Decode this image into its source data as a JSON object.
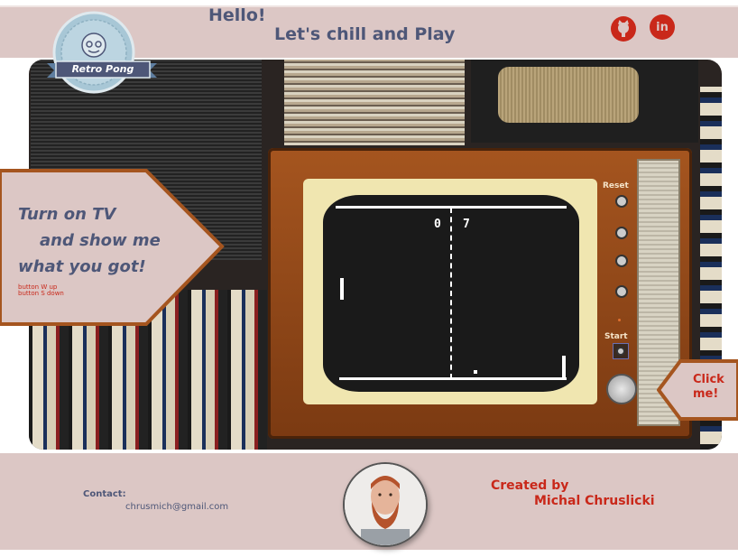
{
  "header": {
    "greeting": "Hello!",
    "tagline": "Let's chill and Play",
    "logo_text": "Retro Pong",
    "github_icon": "github-icon",
    "linkedin_icon": "linkedin-icon",
    "linkedin_label": "in"
  },
  "game": {
    "score_left": "0",
    "score_right": "7",
    "reset_label": "Reset",
    "start_label": "Start"
  },
  "callout": {
    "line1": "Turn on TV",
    "line2": "and show me",
    "line3": "what you got!",
    "hint_up": "button W up",
    "hint_down": "button S down"
  },
  "click_callout": {
    "text": "Click me!"
  },
  "footer": {
    "contact_label": "Contact:",
    "contact_email": "chrusmich@gmail.com",
    "created_by": "Created by",
    "author": "Michal Chruslicki"
  },
  "colors": {
    "bar_bg": "#dcc7c5",
    "accent_red": "#c9281a",
    "text_blue": "#4e5778",
    "callout_border": "#a5551f"
  }
}
